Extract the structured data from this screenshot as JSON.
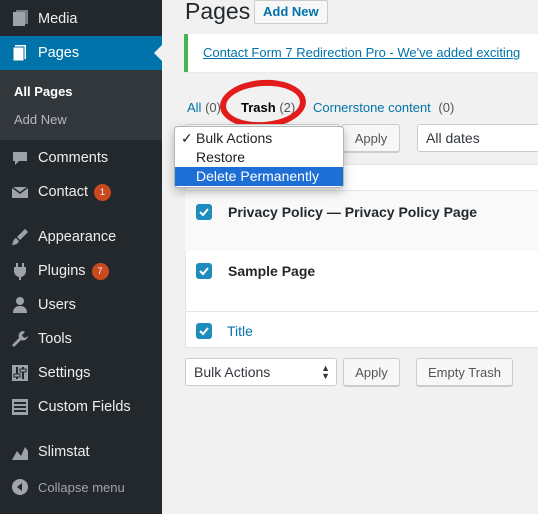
{
  "sidebar": {
    "items": [
      {
        "label": "Media",
        "icon": "media-icon"
      },
      {
        "label": "Pages",
        "icon": "pages-icon",
        "current": true
      },
      {
        "label": "Comments",
        "icon": "comments-icon"
      },
      {
        "label": "Contact",
        "icon": "contact-icon",
        "badge": "1"
      },
      {
        "label": "Appearance",
        "icon": "appearance-icon"
      },
      {
        "label": "Plugins",
        "icon": "plugins-icon",
        "badge": "7"
      },
      {
        "label": "Users",
        "icon": "users-icon"
      },
      {
        "label": "Tools",
        "icon": "tools-icon"
      },
      {
        "label": "Settings",
        "icon": "settings-icon"
      },
      {
        "label": "Custom Fields",
        "icon": "custom-fields-icon"
      },
      {
        "label": "Slimstat",
        "icon": "slimstat-icon"
      }
    ],
    "submenu": {
      "all_pages": "All Pages",
      "add_new": "Add New"
    },
    "collapse": "Collapse menu"
  },
  "header": {
    "title": "Pages",
    "add_new": "Add New"
  },
  "notice": {
    "text": "Contact Form 7 Redirection Pro - We've added exciting"
  },
  "filters": {
    "all": "All",
    "all_count": "(0)",
    "trash": "Trash",
    "trash_count": "(2)",
    "cornerstone": "Cornerstone content",
    "cornerstone_count": "(0)"
  },
  "top_actions": {
    "apply": "Apply",
    "dates": "All dates",
    "dropdown_options": [
      "Bulk Actions",
      "Restore",
      "Delete Permanently"
    ],
    "checked_option": "Bulk Actions",
    "highlighted_option": "Delete Permanently"
  },
  "table": {
    "rows": [
      {
        "title": "Privacy Policy — Privacy Policy Page",
        "checked": true
      },
      {
        "title": "Sample Page",
        "checked": true
      }
    ],
    "footer_column": "Title"
  },
  "bottom_actions": {
    "bulk": "Bulk Actions",
    "apply": "Apply",
    "empty_trash": "Empty Trash"
  },
  "colors": {
    "sidebar": "#23282d",
    "accent": "#0073aa",
    "badge": "#ca4a1f",
    "notice_border": "#46b450",
    "highlight": "#1d6fd6",
    "annotation": "#e31b1b"
  }
}
